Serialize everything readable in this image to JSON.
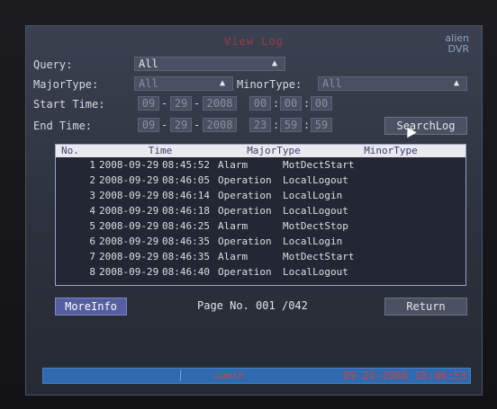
{
  "window": {
    "title": "View Log"
  },
  "logo": {
    "line1": "alien",
    "line2": "DVR"
  },
  "query": {
    "label": "Query:",
    "value": "All"
  },
  "major_type": {
    "label": "MajorType:",
    "value": "All"
  },
  "minor_type": {
    "label": "MinorType:",
    "value": "All"
  },
  "start_time": {
    "label": "Start Time:",
    "month": "09",
    "day": "29",
    "year": "2008",
    "hour": "00",
    "minute": "00",
    "second": "00"
  },
  "end_time": {
    "label": "End Time:",
    "month": "09",
    "day": "29",
    "year": "2008",
    "hour": "23",
    "minute": "59",
    "second": "59"
  },
  "buttons": {
    "search": "SearchLog",
    "more_info": "MoreInfo",
    "return": "Return"
  },
  "table": {
    "headers": [
      "No.",
      "Time",
      "MajorType",
      "MinorType"
    ],
    "rows": [
      {
        "no": "1",
        "date": "2008-09-29",
        "time": "08:45:52",
        "major": "Alarm",
        "minor": "MotDectStart"
      },
      {
        "no": "2",
        "date": "2008-09-29",
        "time": "08:46:05",
        "major": "Operation",
        "minor": "LocalLogout"
      },
      {
        "no": "3",
        "date": "2008-09-29",
        "time": "08:46:14",
        "major": "Operation",
        "minor": "LocalLogin"
      },
      {
        "no": "4",
        "date": "2008-09-29",
        "time": "08:46:18",
        "major": "Operation",
        "minor": "LocalLogout"
      },
      {
        "no": "5",
        "date": "2008-09-29",
        "time": "08:46:25",
        "major": "Alarm",
        "minor": "MotDectStop"
      },
      {
        "no": "6",
        "date": "2008-09-29",
        "time": "08:46:35",
        "major": "Operation",
        "minor": "LocalLogin"
      },
      {
        "no": "7",
        "date": "2008-09-29",
        "time": "08:46:35",
        "major": "Alarm",
        "minor": "MotDectStart"
      },
      {
        "no": "8",
        "date": "2008-09-29",
        "time": "08:46:40",
        "major": "Operation",
        "minor": "LocalLogout"
      }
    ]
  },
  "pagination": {
    "label": "Page No.",
    "current": "001",
    "total": "042"
  },
  "status": {
    "user": "admin",
    "datetime": "09-29-2008 18:46:53"
  },
  "icons": {
    "dropdown": "updown-arrow-icon",
    "cursor": "mouse-pointer-icon"
  },
  "colors": {
    "accent": "#545ea0",
    "status_bar": "#2f6ab0",
    "status_text": "#c7453f",
    "title": "#9a3a48"
  }
}
